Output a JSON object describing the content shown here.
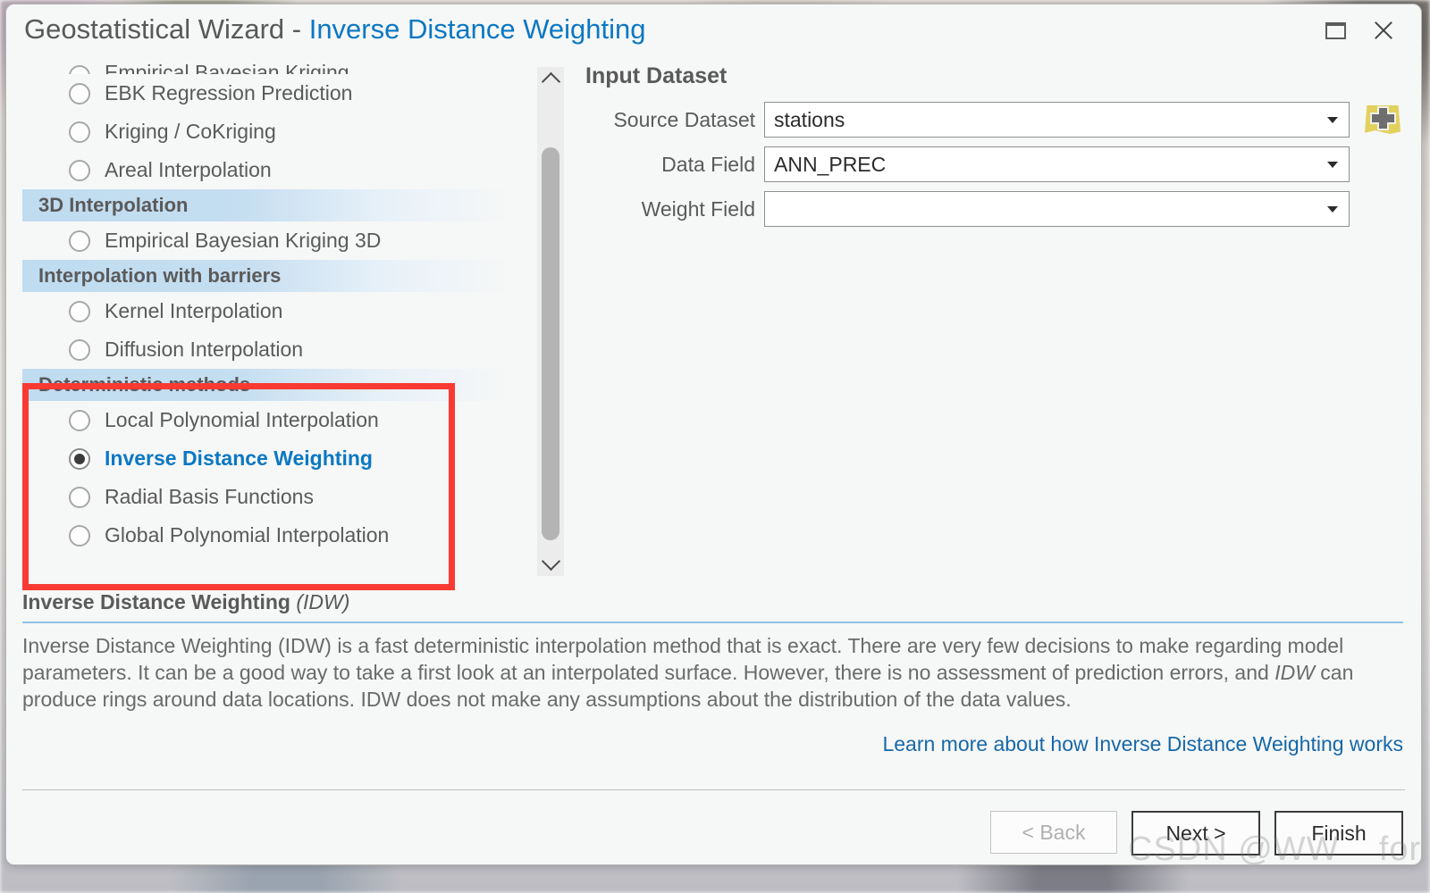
{
  "window": {
    "title_main": "Geostatistical Wizard",
    "title_sep": " - ",
    "title_method": "Inverse Distance Weighting",
    "restore_icon": "restore-window-icon",
    "close_icon": "close-icon",
    "accent_color": "#0b78c3",
    "annotation_box_color": "#f93a33"
  },
  "method_list": {
    "items": [
      {
        "type": "method",
        "label": "Empirical Bayesian Kriging",
        "selected": false,
        "clipped": true
      },
      {
        "type": "method",
        "label": "EBK Regression Prediction",
        "selected": false
      },
      {
        "type": "method",
        "label": "Kriging / CoKriging",
        "selected": false
      },
      {
        "type": "method",
        "label": "Areal Interpolation",
        "selected": false
      },
      {
        "type": "group",
        "label": "3D Interpolation"
      },
      {
        "type": "method",
        "label": "Empirical Bayesian Kriging 3D",
        "selected": false
      },
      {
        "type": "group",
        "label": "Interpolation with barriers"
      },
      {
        "type": "method",
        "label": "Kernel Interpolation",
        "selected": false
      },
      {
        "type": "method",
        "label": "Diffusion Interpolation",
        "selected": false
      },
      {
        "type": "group",
        "label": "Deterministic methods"
      },
      {
        "type": "method",
        "label": "Local Polynomial Interpolation",
        "selected": false
      },
      {
        "type": "method",
        "label": "Inverse Distance Weighting",
        "selected": true
      },
      {
        "type": "method",
        "label": "Radial Basis Functions",
        "selected": false
      },
      {
        "type": "method",
        "label": "Global Polynomial Interpolation",
        "selected": false
      }
    ]
  },
  "scrollbar": {
    "up_icon": "chevron-up-icon",
    "down_icon": "chevron-down-icon"
  },
  "input_dataset": {
    "title": "Input Dataset",
    "fields": [
      {
        "label": "Source Dataset",
        "value": "stations",
        "placeholder": ""
      },
      {
        "label": "Data Field",
        "value": "ANN_PREC",
        "placeholder": ""
      },
      {
        "label": "Weight Field",
        "value": "",
        "placeholder": ""
      }
    ],
    "add_button_icon": "add-data-icon"
  },
  "description": {
    "heading_bold": "Inverse Distance Weighting ",
    "heading_italic": "(IDW)",
    "body_part1": "Inverse Distance Weighting (IDW) is a fast deterministic interpolation method that is exact. There are very few decisions to make regarding model parameters. It can be a good way to take a first look at an interpolated surface. However, there is no assessment of prediction errors, and ",
    "body_italic": "IDW",
    "body_part2": " can produce rings around data locations. IDW does not make any assumptions about the distribution of the data values.",
    "learn_more": "Learn more about how Inverse Distance Weighting works"
  },
  "footer": {
    "back_label": "< Back",
    "next_label": "Next >",
    "finish_label": "Finish"
  },
  "watermark": {
    "text": "CSDN @WW__forever"
  }
}
